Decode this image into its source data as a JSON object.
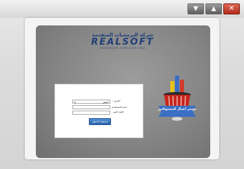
{
  "window": {
    "controls": {
      "minimize_symbol": "▼",
      "maximize_symbol": "▲",
      "close_symbol": "✕"
    }
  },
  "brand": {
    "arabic_name": "شركة البرمجيات المتقدمة",
    "english_name": "REALSOFT",
    "tagline": "ADVANCED APPLICATIONS"
  },
  "login": {
    "branch_label": "الفـرع :",
    "branch_value": "المقر",
    "username_label": "اسم المستخدم",
    "password_label": "كلمة السر",
    "submit_label": "تسجيل الدخول"
  },
  "logo": {
    "caption": "مؤشر أعمال المستهلكين"
  },
  "colors": {
    "brand_blue": "#1f3e78",
    "button_blue": "#2c64ad",
    "close_red": "#b22b1a",
    "basket_red": "#c8251c"
  }
}
